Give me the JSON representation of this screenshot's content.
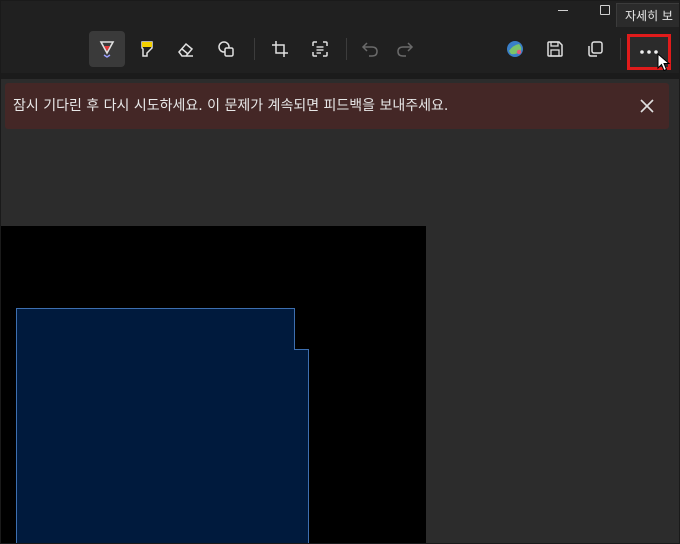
{
  "tooltip": {
    "text": "자세히 보"
  },
  "toolbar": {
    "tools": [
      {
        "name": "ballpoint-pen-icon",
        "selected": true
      },
      {
        "name": "highlighter-icon",
        "selected": false
      },
      {
        "name": "eraser-icon",
        "selected": false
      },
      {
        "name": "shapes-icon",
        "selected": false
      },
      {
        "name": "crop-icon",
        "selected": false
      },
      {
        "name": "text-actions-icon",
        "selected": false
      },
      {
        "name": "undo-icon",
        "selected": false
      },
      {
        "name": "redo-icon",
        "selected": false
      },
      {
        "name": "paint-icon",
        "selected": false
      },
      {
        "name": "save-icon",
        "selected": false
      },
      {
        "name": "copy-icon",
        "selected": false
      },
      {
        "name": "more-options-icon",
        "selected": false
      }
    ]
  },
  "infobar": {
    "message": "잠시 기다린 후 다시 시도하세요. 이 문제가 계속되면 피드백을 보내주세요."
  },
  "colors": {
    "background": "#202020",
    "content": "#2c2c2c",
    "infobar": "#442726",
    "highlight_border": "#e01b1b",
    "shape_fill": "#001a3d",
    "shape_stroke": "#3d6fb0",
    "pen_accent": "#e13b3b",
    "highlighter_accent": "#f3d000"
  }
}
